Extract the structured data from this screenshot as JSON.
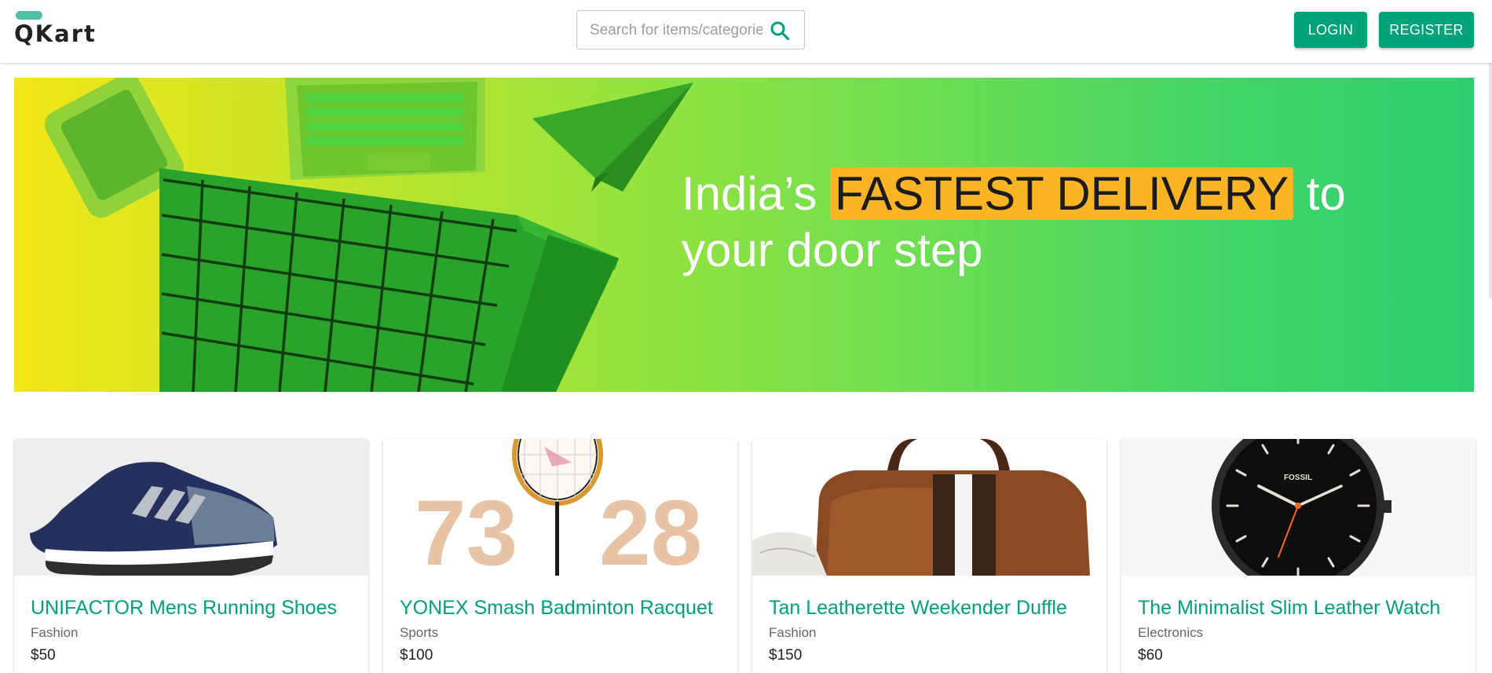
{
  "header": {
    "logo_text": "QKart",
    "search_placeholder": "Search for items/categories",
    "login_label": "LOGIN",
    "register_label": "REGISTER"
  },
  "hero": {
    "text_before": "India’s ",
    "highlight": "FASTEST DELIVERY",
    "text_after": " to your door step"
  },
  "products": [
    {
      "name": "UNIFACTOR Mens Running Shoes",
      "category": "Fashion",
      "price": "$50",
      "image": "shoe-image"
    },
    {
      "name": "YONEX Smash Badminton Racquet",
      "category": "Sports",
      "price": "$100",
      "image": "racquet-image",
      "image_text": [
        "73",
        "28"
      ]
    },
    {
      "name": "Tan Leatherette Weekender Duffle",
      "category": "Fashion",
      "price": "$150",
      "image": "duffle-bag-image"
    },
    {
      "name": "The Minimalist Slim Leather Watch",
      "category": "Electronics",
      "price": "$60",
      "image": "watch-image",
      "image_text": "FOSSIL"
    }
  ],
  "colors": {
    "brand_green": "#00a278",
    "highlight_orange": "#fbb423"
  }
}
